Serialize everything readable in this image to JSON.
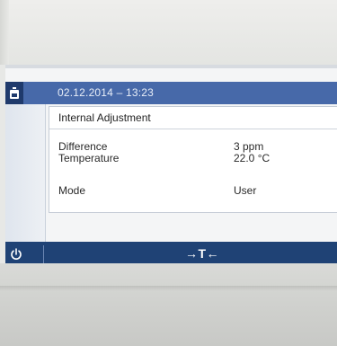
{
  "header": {
    "datetime": "02.12.2014 – 13:23",
    "icon": "weighing-bottle-icon"
  },
  "panel": {
    "title": "Internal Adjustment",
    "rows": [
      {
        "label": "Difference",
        "value": "3 ppm"
      },
      {
        "label": "Temperature",
        "value": "22.0 °C"
      },
      {
        "label": "Mode",
        "value": "User"
      }
    ]
  },
  "footer": {
    "power_icon": "power-icon",
    "tare_label": "→T←"
  },
  "colors": {
    "header_blue": "#4769a9",
    "footer_navy": "#1f4275",
    "icon_box": "#1f3a6c"
  }
}
